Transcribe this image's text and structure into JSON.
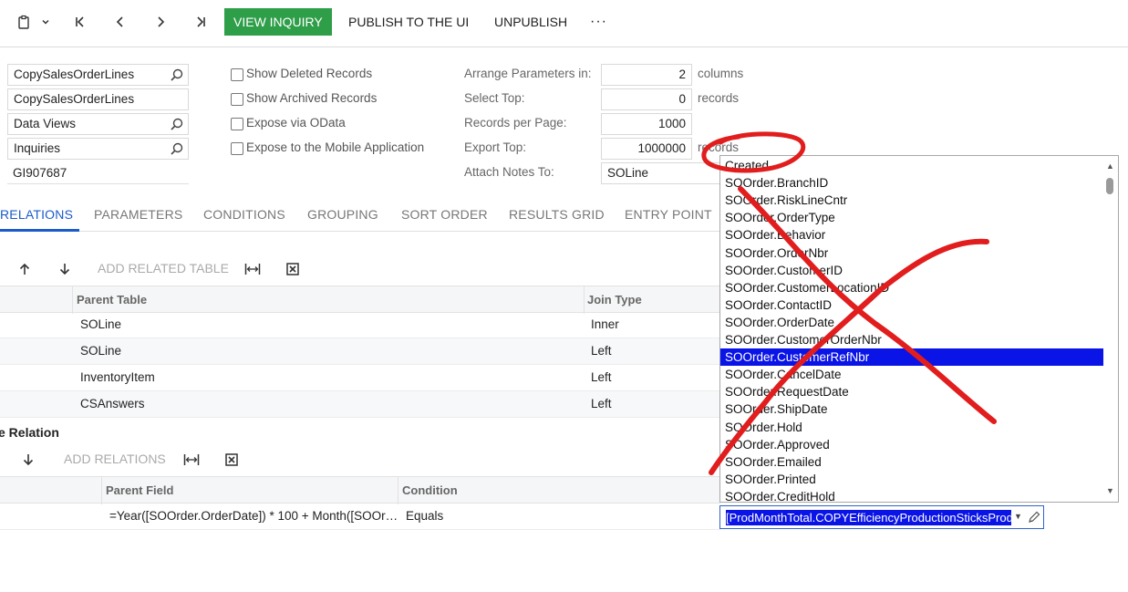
{
  "toolbar": {
    "view_inquiry": "VIEW INQUIRY",
    "publish": "PUBLISH TO THE UI",
    "unpublish": "UNPUBLISH",
    "more": "···"
  },
  "form": {
    "inquiry_title": "CopySalesOrderLines",
    "site_map_title": "CopySalesOrderLines",
    "workspace": "Data Views",
    "category": "Inquiries",
    "screen_id": "GI907687",
    "checkboxes": {
      "show_deleted": "Show Deleted Records",
      "show_archived": "Show Archived Records",
      "expose_odata": "Expose via OData",
      "expose_mobile": "Expose to the Mobile Application"
    },
    "params": {
      "arrange_label": "Arrange Parameters in:",
      "arrange_value": "2",
      "arrange_unit": "columns",
      "select_top_label": "Select Top:",
      "select_top_value": "0",
      "select_top_unit": "records",
      "per_page_label": "Records per Page:",
      "per_page_value": "1000",
      "export_top_label": "Export Top:",
      "export_top_value": "1000000",
      "export_top_unit": "records",
      "attach_notes_label": "Attach Notes To:",
      "attach_notes_value": "SOLine"
    }
  },
  "tabs": [
    "RELATIONS",
    "PARAMETERS",
    "CONDITIONS",
    "GROUPING",
    "SORT ORDER",
    "RESULTS GRID",
    "ENTRY POINT"
  ],
  "relations_grid": {
    "toolbar_add": "ADD RELATED TABLE",
    "headers": {
      "parent_table": "Parent Table",
      "join_type": "Join Type"
    },
    "rows": [
      {
        "parent": "SOLine",
        "join": "Inner"
      },
      {
        "parent": "SOLine",
        "join": "Left"
      },
      {
        "parent": "InventoryItem",
        "join": "Left"
      },
      {
        "parent": "CSAnswers",
        "join": "Left"
      }
    ]
  },
  "data_field_links": {
    "title": "e Relation",
    "toolbar_add": "ADD RELATIONS",
    "headers": {
      "parent_field": "Parent Field",
      "condition": "Condition"
    },
    "rows": [
      {
        "parent_field": "=Year([SOOrder.OrderDate]) * 100 + Month([SOOr…",
        "condition": "Equals",
        "child_field": "[ProdMonthTotal.COPYEfficiencyProductionSticksProd"
      }
    ]
  },
  "dropdown": {
    "items": [
      "Created",
      "SOOrder.BranchID",
      "SOOrder.RiskLineCntr",
      "SOOrder.OrderType",
      "SOOrder.Behavior",
      "SOOrder.OrderNbr",
      "SOOrder.CustomerID",
      "SOOrder.CustomerLocationID",
      "SOOrder.ContactID",
      "SOOrder.OrderDate",
      "SOOrder.CustomerOrderNbr",
      "SOOrder.CustomerRefNbr",
      "SOOrder.CancelDate",
      "SOOrder.RequestDate",
      "SOOrder.ShipDate",
      "SOOrder.Hold",
      "SOOrder.Approved",
      "SOOrder.Emailed",
      "SOOrder.Printed",
      "SOOrder.CreditHold"
    ],
    "selected_index": 11
  },
  "colors": {
    "primary_button": "#2e9e49",
    "active_tab": "#1a5cc8",
    "selection": "#0a14e6",
    "annotation_red": "#e11d1d"
  },
  "icons": {
    "clipboard": "clipboard-icon",
    "first": "first-page-icon",
    "prev": "previous-icon",
    "next": "next-icon",
    "last": "last-page-icon",
    "search": "search-icon",
    "arrow_up": "arrow-up-icon",
    "arrow_down": "arrow-down-icon",
    "fit_columns": "fit-columns-icon",
    "export_excel": "export-excel-icon",
    "pencil": "pencil-icon"
  }
}
